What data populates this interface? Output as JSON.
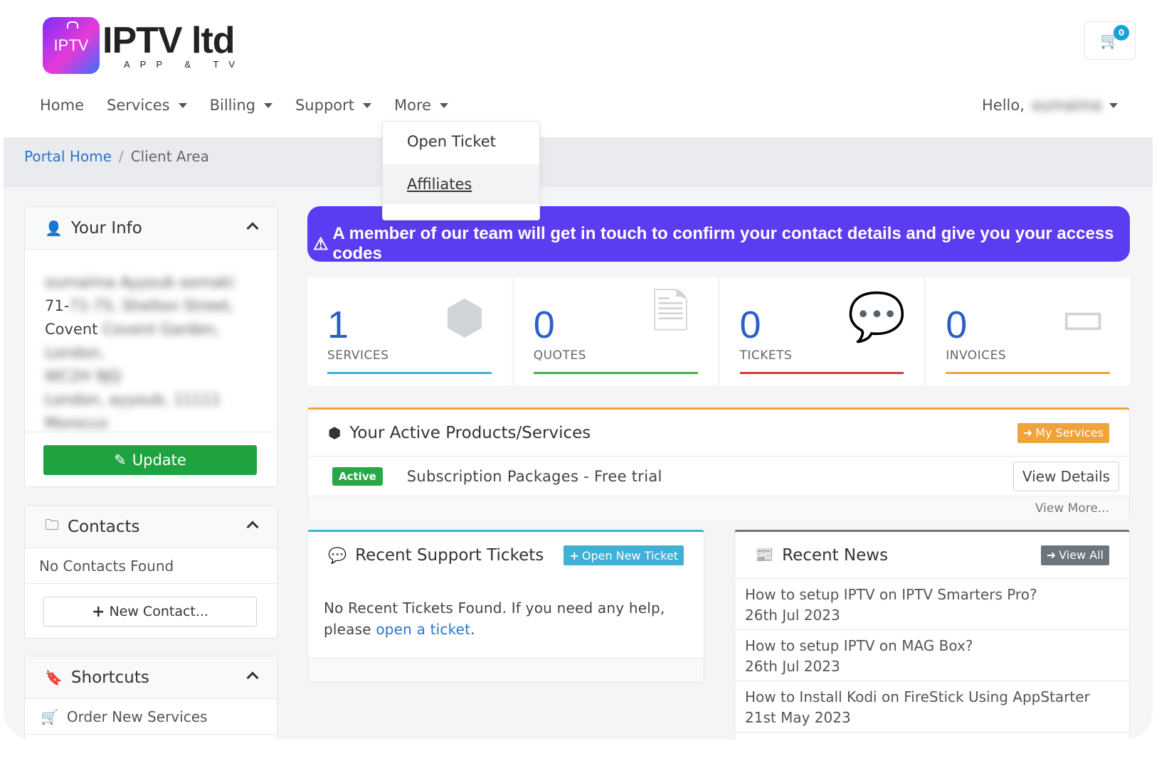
{
  "brand": {
    "logo_box_text": "IPTV",
    "logo_title": "IPTV ltd",
    "logo_subtitle": "APP & TV"
  },
  "cart": {
    "count": "0",
    "icon": "cart-icon"
  },
  "nav": {
    "items": [
      {
        "label": "Home",
        "has_caret": false
      },
      {
        "label": "Services",
        "has_caret": true
      },
      {
        "label": "Billing",
        "has_caret": true
      },
      {
        "label": "Support",
        "has_caret": true
      },
      {
        "label": "More",
        "has_caret": true
      }
    ],
    "hello_prefix": "Hello,",
    "hello_name": "oumaima"
  },
  "more_dropdown": {
    "items": [
      "Open Ticket",
      "Affiliates"
    ]
  },
  "breadcrumb": {
    "home": "Portal Home",
    "separator": "/",
    "current": "Client Area"
  },
  "your_info": {
    "title": "Your Info",
    "lines": [
      "oumaima Ayyoub oomaki",
      "71-75, Shelton Street,",
      "Covent Garden, London,",
      "WC2H 9JQ",
      "London, ayyoub, 11111",
      "Morocco"
    ],
    "update_label": "Update"
  },
  "contacts": {
    "title": "Contacts",
    "empty_text": "No Contacts Found",
    "new_contact_label": "New Contact..."
  },
  "shortcuts": {
    "title": "Shortcuts",
    "items": [
      "Order New Services"
    ]
  },
  "alert": {
    "icon": "warning-icon",
    "text": "A member of our team will get in touch to confirm your contact details and give you your access codes",
    "color": "#5b3cf0"
  },
  "stats": [
    {
      "value": "1",
      "label": "SERVICES",
      "color": "#3fb1d6",
      "icon": "box-icon"
    },
    {
      "value": "0",
      "label": "QUOTES",
      "color": "#46b04a",
      "icon": "document-icon"
    },
    {
      "value": "0",
      "label": "TICKETS",
      "color": "#d9383a",
      "icon": "chat-icon"
    },
    {
      "value": "0",
      "label": "INVOICES",
      "color": "#f0a23b",
      "icon": "credit-card-icon"
    }
  ],
  "products": {
    "title": "Your Active Products/Services",
    "my_services_label": "My Services",
    "rows": [
      {
        "status": "Active",
        "name": "Subscription Packages - Free trial",
        "action": "View Details"
      }
    ],
    "view_more": "View More..."
  },
  "tickets": {
    "title": "Recent Support Tickets",
    "open_new_label": "Open New Ticket",
    "empty_text": "No Recent Tickets Found. If you need any help, please",
    "link_text": "open a ticket",
    "suffix": "."
  },
  "news": {
    "title": "Recent News",
    "view_all_label": "View All",
    "items": [
      {
        "title": "How to setup IPTV on IPTV Smarters Pro?",
        "date": "26th Jul 2023"
      },
      {
        "title": "How to setup IPTV on MAG Box?",
        "date": "26th Jul 2023"
      },
      {
        "title": "How to Install Kodi on FireStick Using AppStarter",
        "date": "21st May 2023"
      }
    ]
  }
}
